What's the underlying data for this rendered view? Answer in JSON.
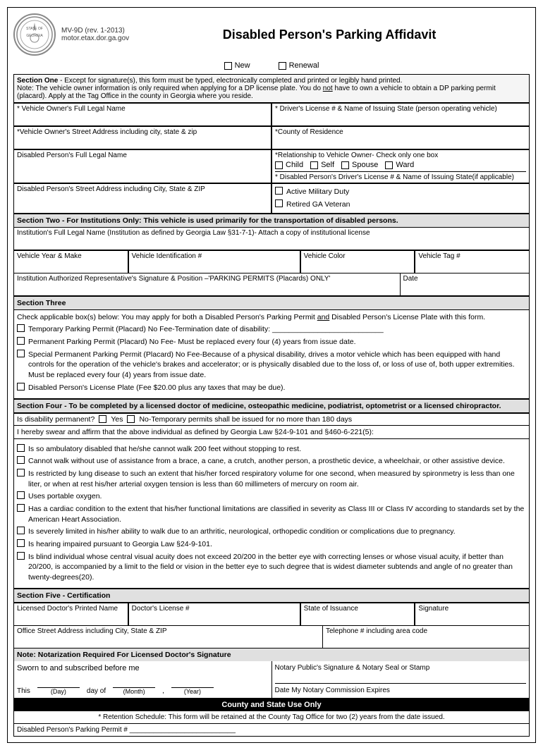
{
  "header": {
    "form_id": "MV-9D (rev. 1-2013)",
    "website": "motor.etax.dor.ga.gov",
    "title": "Disabled Person's Parking Affidavit"
  },
  "new_renewal": {
    "new_label": "New",
    "renewal_label": "Renewal"
  },
  "section_one": {
    "header": "Section One",
    "note": "- Except for signature(s), this form must be typed, electronically completed and printed or legibly hand printed.\nNote:  The vehicle owner information is only required when applying for a DP license plate.  You do not have to own a vehicle to obtain a DP parking permit (placard).  Apply at the Tag Office in the county in Georgia where you reside.",
    "fields": {
      "vehicle_owner_name": "* Vehicle Owner's Full Legal Name",
      "drivers_license": "* Driver's License # & Name of Issuing State (person operating vehicle)",
      "street_address": "*Vehicle Owner's Street Address including city, state & zip",
      "county_residence": "*County of Residence",
      "disabled_person_name": "Disabled Person's Full Legal Name",
      "relationship_label": "*Relationship to Vehicle Owner- Check only one box",
      "relationship_options": [
        "Child",
        "Self",
        "Spouse",
        "Ward"
      ],
      "disabled_drivers_license": "* Disabled Person's Driver's License # & Name of Issuing State(if applicable)",
      "disabled_street_address": "Disabled Person's Street Address including City, State & ZIP",
      "active_military": "Active Military Duty",
      "retired_veteran": "Retired GA Veteran"
    }
  },
  "section_two": {
    "header": "Section Two - For Institutions Only:",
    "note": "This vehicle is used primarily for the transportation of disabled persons.",
    "institution_name": "Institution's Full Legal Name (Institution as defined by Georgia Law §31-7-1)- Attach a copy of institutional license",
    "col1": "Vehicle Year & Make",
    "col2": "Vehicle Identification #",
    "col3": "Vehicle Color",
    "col4": "Vehicle Tag #",
    "sig_label": "Institution Authorized Representative's Signature & Position –'PARKING PERMITS (Placards) ONLY'",
    "date_label": "Date"
  },
  "section_three": {
    "header": "Section Three",
    "intro": "Check applicable box(s) below: You may apply for both a Disabled Person's Parking Permit and Disabled Person's License Plate with this form.",
    "options": [
      "Temporary Parking Permit (Placard) No Fee-Termination date of disability: ___________________________",
      "Permanent Parking Permit (Placard) No Fee- Must be replaced every four (4) years from issue date.",
      "Special Permanent Parking Permit (Placard) No Fee-Because of a physical disability, drives a motor vehicle which has been equipped with hand controls for the operation of the vehicle's brakes and accelerator; or is physically disabled due to the loss of, or loss of use of, both upper extremities.  Must be replaced every four (4) years from issue date.",
      "Disabled Person's License Plate (Fee $20.00 plus any taxes that may be due)."
    ]
  },
  "section_four": {
    "header": "Section Four",
    "note": "- To be completed by a licensed doctor of medicine, osteopathic medicine, podiatrist, optometrist or a licensed chiropractor.",
    "disability_permanent": "Is disability permanent?",
    "yes_label": "Yes",
    "no_label": "No-Temporary permits shall be issued for no more than 180 days",
    "affirm": "I hereby swear and affirm that the above individual as defined by Georgia Law §24-9-101 and §460-6-221(5):",
    "conditions": [
      "Is so ambulatory disabled that he/she cannot walk 200 feet without stopping to rest.",
      "Cannot walk without use of assistance from a brace, a cane, a crutch, another person, a prosthetic device, a wheelchair, or other assistive device.",
      "Is restricted by lung disease to such an extent that his/her forced respiratory volume for one second, when measured by spironmetry is less than one liter, or when at rest his/her arterial oxygen tension is less than 60 millimeters of mercury on room air.",
      "Uses portable oxygen.",
      "Has a cardiac condition to the extent that his/her functional limitations are classified in severity as Class III or Class IV according to standards set by the American Heart Association.",
      "Is severely limited in his/her ability to walk due to an arthritic, neurological, orthopedic condition or complications due to pregnancy.",
      "Is hearing impaired pursuant to Georgia Law §24-9-101.",
      "Is blind individual whose central visual acuity does not exceed 20/200 in the better eye with correcting lenses or whose visual acuity, if better than 20/200, is accompanied by a limit to the field or vision in the better eye to such degree that is widest diameter subtends and angle of no greater than twenty-degrees(20)."
    ]
  },
  "section_five": {
    "header": "Section Five - Certification",
    "col1": "Licensed Doctor's Printed Name",
    "col2": "Doctor's License #",
    "col3": "State of Issuance",
    "col4": "Signature",
    "row2_col1": "Office Street Address including City, State & ZIP",
    "row2_col2": "Telephone # including area code"
  },
  "notary": {
    "header": "Note: Notarization Required For Licensed Doctor's Signature",
    "sworn": "Sworn to and subscribed before me",
    "this": "This",
    "day_of": "day of",
    "day_label": "(Day)",
    "month_label": "(Month)",
    "year_label": "(Year)",
    "notary_public": "Notary Public's Signature & Notary Seal or Stamp",
    "date_expires": "Date My Notary Commission Expires"
  },
  "county": {
    "header": "County and State Use Only",
    "note": "* Retention Schedule: This form will be retained at the County Tag Office for two (2) years from the date issued.",
    "permit_label": "Disabled Person's Parking Permit #"
  }
}
